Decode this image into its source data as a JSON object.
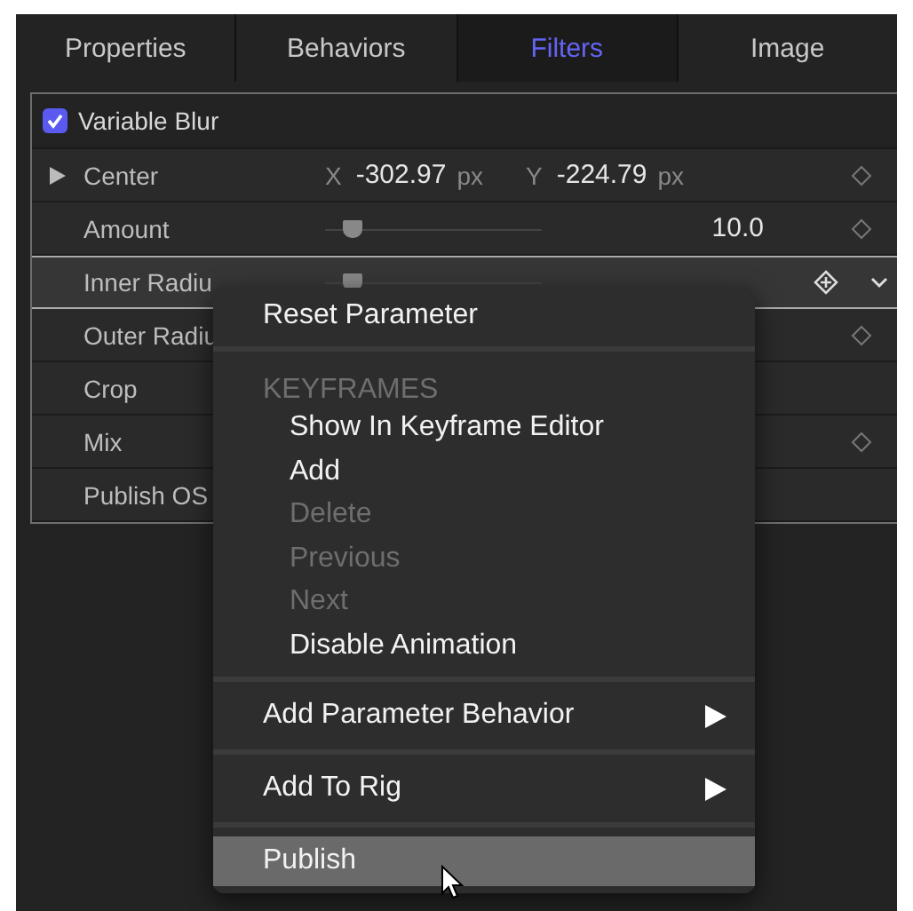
{
  "tabs": [
    {
      "label": "Properties",
      "selected": false
    },
    {
      "label": "Behaviors",
      "selected": false
    },
    {
      "label": "Filters",
      "selected": true
    },
    {
      "label": "Image",
      "selected": false
    }
  ],
  "filter": {
    "name": "Variable Blur",
    "enabled": true
  },
  "parameters": [
    {
      "kind": "point",
      "label": "Center",
      "expanded": false,
      "x_label": "X",
      "x_value": "-302.97",
      "x_unit": "px",
      "y_label": "Y",
      "y_value": "-224.79",
      "y_unit": "px",
      "keyframe_button": true,
      "animated": false,
      "selected": false
    },
    {
      "kind": "slider",
      "label": "Amount",
      "level": 0.12,
      "value": "10.0",
      "keyframe_button": true,
      "animated": false,
      "selected": false
    },
    {
      "kind": "slider",
      "label": "Inner Radiu",
      "level": 0.12,
      "keyframe_button": true,
      "animated": true,
      "selected": true
    },
    {
      "kind": "plain",
      "label": "Outer Radiu",
      "keyframe_button": true,
      "animated": false,
      "selected": false
    },
    {
      "kind": "plain",
      "label": "Crop",
      "keyframe_button": false,
      "selected": false
    },
    {
      "kind": "plain",
      "label": "Mix",
      "keyframe_button": true,
      "animated": false,
      "selected": false
    },
    {
      "kind": "plain",
      "label": "Publish OS",
      "keyframe_button": false,
      "selected": false
    }
  ],
  "context_menu": [
    {
      "kind": "item",
      "label": "Reset Parameter",
      "disabled": false,
      "submenu": false,
      "selected": false
    },
    {
      "kind": "separator"
    },
    {
      "kind": "header",
      "label": "KEYFRAMES"
    },
    {
      "kind": "subitem",
      "label": "Show In Keyframe Editor",
      "disabled": false,
      "submenu": false,
      "selected": false
    },
    {
      "kind": "subitem",
      "label": "Add",
      "disabled": false,
      "submenu": false,
      "selected": false
    },
    {
      "kind": "subitem",
      "label": "Delete",
      "disabled": true,
      "submenu": false,
      "selected": false
    },
    {
      "kind": "subitem",
      "label": "Previous",
      "disabled": true,
      "submenu": false,
      "selected": false
    },
    {
      "kind": "subitem",
      "label": "Next",
      "disabled": true,
      "submenu": false,
      "selected": false
    },
    {
      "kind": "subitem",
      "label": "Disable Animation",
      "disabled": false,
      "submenu": false,
      "selected": false
    },
    {
      "kind": "separator"
    },
    {
      "kind": "item",
      "label": "Add Parameter Behavior",
      "disabled": false,
      "submenu": true,
      "selected": false
    },
    {
      "kind": "separator"
    },
    {
      "kind": "item",
      "label": "Add To Rig",
      "disabled": false,
      "submenu": true,
      "selected": false
    },
    {
      "kind": "separator"
    },
    {
      "kind": "item",
      "label": "Publish",
      "disabled": false,
      "submenu": false,
      "selected": true
    }
  ]
}
